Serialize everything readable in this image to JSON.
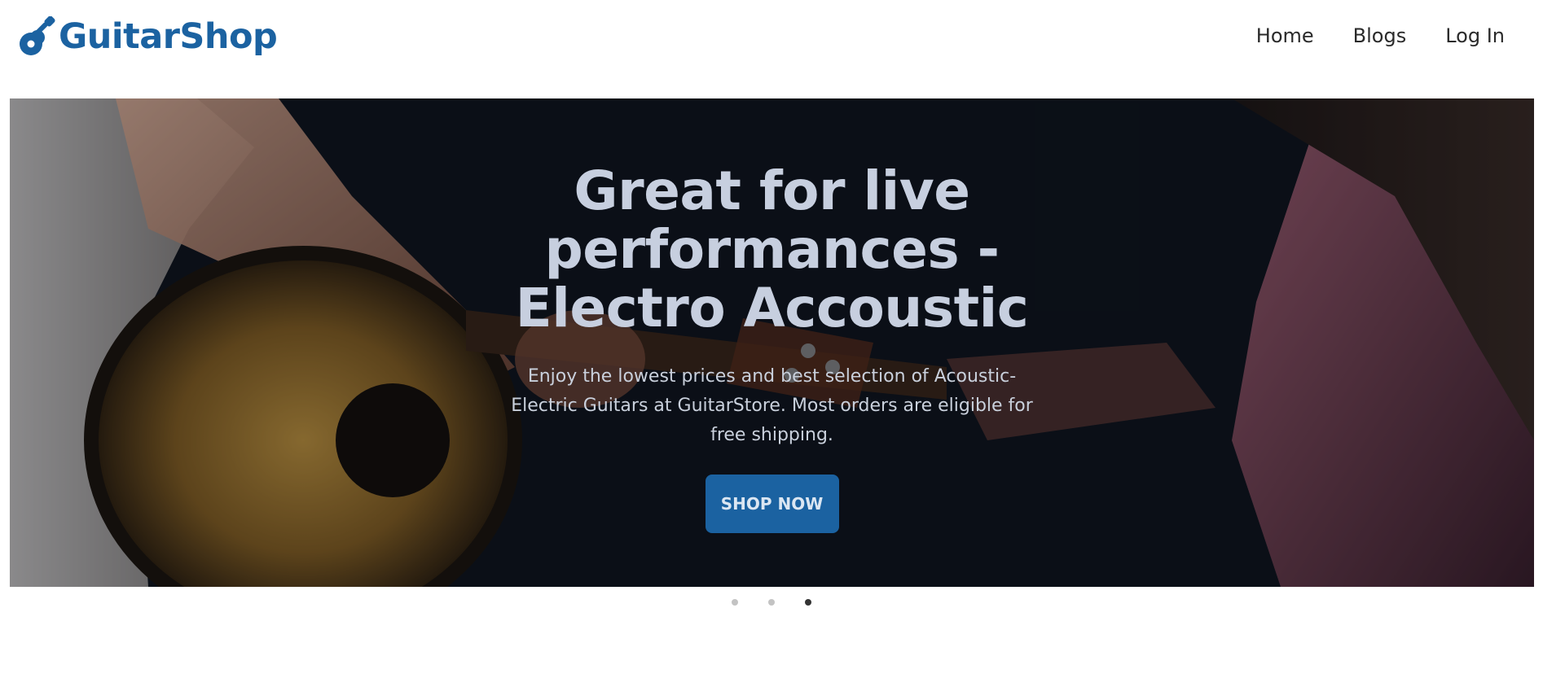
{
  "header": {
    "logo_text": "GuitarShop",
    "logo_icon": "guitar-icon",
    "nav": [
      {
        "label": "Home"
      },
      {
        "label": "Blogs"
      },
      {
        "label": "Log In"
      }
    ]
  },
  "hero": {
    "title": "Great for live performances - Electro Accoustic",
    "description": "Enjoy the lowest prices and best selection of Acoustic-Electric Guitars at GuitarStore. Most orders are eligible for free shipping.",
    "cta_label": "SHOP NOW",
    "image": "person-playing-acoustic-guitar"
  },
  "carousel": {
    "slide_count": 3,
    "active_slide": 3
  },
  "colors": {
    "brand": "#1b62a1",
    "hero_text": "#c7cfdf",
    "dot_inactive": "#c3c3c3",
    "dot_active": "#333333"
  }
}
